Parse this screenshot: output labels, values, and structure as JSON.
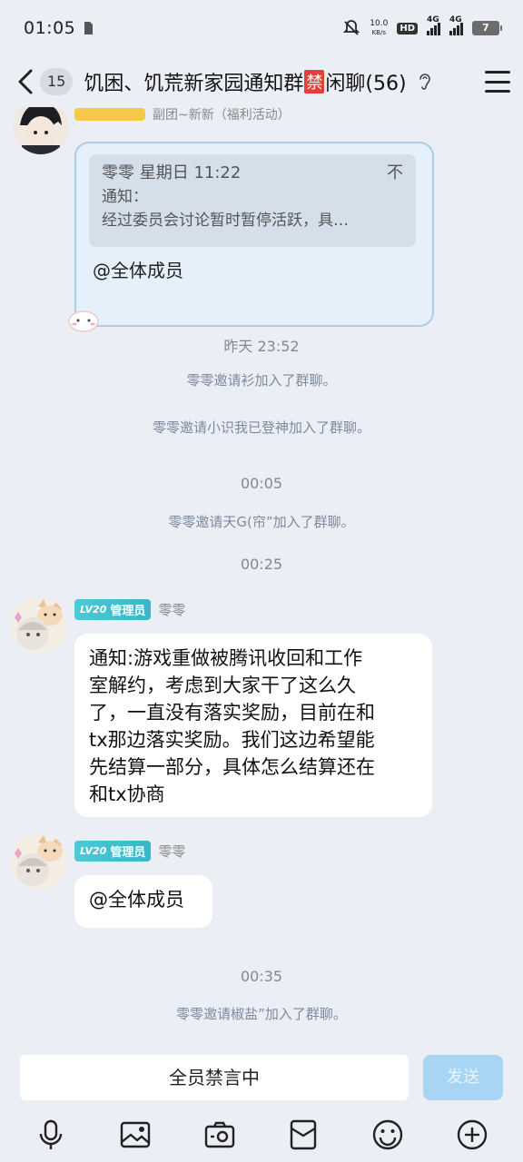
{
  "status_bar": {
    "time": "01:05",
    "net_speed_value": "10.0",
    "net_speed_unit": "KB/s",
    "hd_label": "HD",
    "signal1_label": "4G",
    "signal2_label": "4G",
    "battery": "7"
  },
  "header": {
    "unread_count": "15",
    "title_part1": "饥困、饥荒新家园通知群",
    "title_tag": "禁",
    "title_part2": "闲聊(56)"
  },
  "pinned_message": {
    "partial_caption": "副团~新新（福利活动）",
    "quote_author": "零零",
    "quote_time": "星期日 11:22",
    "quote_pin_glyph": "不",
    "quote_line1": "通知：",
    "quote_line2": "经过委员会讨论暂时暂停活跃，具…",
    "mention": "@全体成员"
  },
  "timeline": [
    {
      "type": "time",
      "text": "昨天 23:52"
    },
    {
      "type": "system",
      "text": "零零邀请衫加入了群聊。"
    },
    {
      "type": "system",
      "text": "零零邀请小识我已登神加入了群聊。"
    },
    {
      "type": "time",
      "text": "00:05"
    },
    {
      "type": "system",
      "text": "零零邀请天G(帘”加入了群聊。"
    },
    {
      "type": "time",
      "text": "00:25"
    },
    {
      "type": "time",
      "text": "00:35"
    },
    {
      "type": "system",
      "text": "零零邀请椒盐”加入了群聊。"
    }
  ],
  "messages": [
    {
      "level": "LV20",
      "role": "管理员",
      "sender": "零零",
      "text_lines": [
        "通知:游戏重做被腾讯收回和工作",
        "室解约，考虑到大家干了这么久",
        "了，一直没有落实奖励，目前在和",
        "tx那边落实奖励。我们这边希望能",
        "先结算一部分，具体怎么结算还在",
        "和tx协商"
      ]
    },
    {
      "level": "LV20",
      "role": "管理员",
      "sender": "零零",
      "text_lines": [
        "@全体成员"
      ]
    }
  ],
  "input": {
    "placeholder": "全员禁言中",
    "send_label": "发送"
  },
  "toolbar": [
    "mic-icon",
    "image-icon",
    "camera-icon",
    "red-packet-icon",
    "emoji-icon",
    "plus-icon"
  ]
}
